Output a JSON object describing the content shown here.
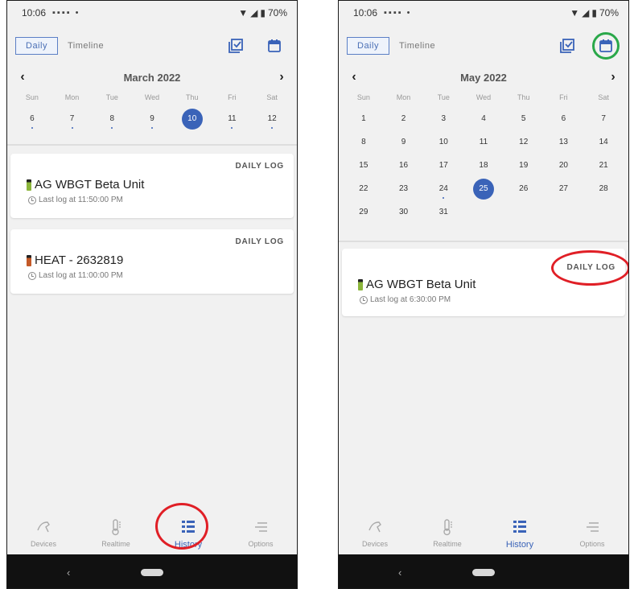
{
  "left": {
    "status": {
      "time": "10:06",
      "battery": "70%"
    },
    "tabs": [
      "Daily",
      "Timeline"
    ],
    "month": "March 2022",
    "dow": [
      "Sun",
      "Mon",
      "Tue",
      "Wed",
      "Thu",
      "Fri",
      "Sat"
    ],
    "weeks": [
      [
        6,
        7,
        8,
        9,
        10,
        11,
        12
      ]
    ],
    "selected_day": 10,
    "dotted_days": [
      6,
      7,
      8,
      9,
      11,
      12
    ],
    "cards": [
      {
        "badge": "DAILY LOG",
        "name": "AG WBGT Beta Unit",
        "last_log": "Last log at 11:50:00 PM",
        "device_color": "#8bb53a"
      },
      {
        "badge": "DAILY LOG",
        "name": "HEAT - 2632819",
        "last_log": "Last log at 11:00:00 PM",
        "device_color": "#c45a28"
      }
    ],
    "nav": [
      "Devices",
      "Realtime",
      "History",
      "Options"
    ],
    "active_nav": "History"
  },
  "right": {
    "status": {
      "time": "10:06",
      "battery": "70%"
    },
    "tabs": [
      "Daily",
      "Timeline"
    ],
    "month": "May 2022",
    "dow": [
      "Sun",
      "Mon",
      "Tue",
      "Wed",
      "Thu",
      "Fri",
      "Sat"
    ],
    "weeks": [
      [
        1,
        2,
        3,
        4,
        5,
        6,
        7
      ],
      [
        8,
        9,
        10,
        11,
        12,
        13,
        14
      ],
      [
        15,
        16,
        17,
        18,
        19,
        20,
        21
      ],
      [
        22,
        23,
        24,
        25,
        26,
        27,
        28
      ],
      [
        29,
        30,
        31
      ]
    ],
    "selected_day": 25,
    "dotted_days": [
      24
    ],
    "cards": [
      {
        "badge": "DAILY LOG",
        "name": "AG WBGT Beta Unit",
        "last_log": "Last log at 6:30:00 PM",
        "device_color": "#8bb53a"
      }
    ],
    "nav": [
      "Devices",
      "Realtime",
      "History",
      "Options"
    ],
    "active_nav": "History"
  },
  "colors": {
    "accent": "#3a63b8",
    "highlight_red": "#e01f26",
    "highlight_green": "#2aa84a"
  }
}
